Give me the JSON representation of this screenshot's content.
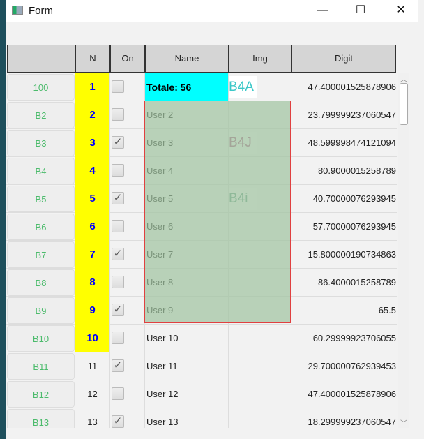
{
  "window": {
    "title": "Form",
    "minimize": "—",
    "maximize": "☐",
    "close": "✕"
  },
  "columns": [
    "",
    "N",
    "On",
    "Name",
    "Img",
    "Digit"
  ],
  "rows": [
    {
      "header": "100",
      "n": "1",
      "hl": true,
      "on": false,
      "name": "Totale: 56",
      "total": true,
      "img": "B4A",
      "imgColor": "#3cc8c8",
      "digit": "47.400001525878906"
    },
    {
      "header": "B2",
      "n": "2",
      "hl": true,
      "on": false,
      "name": "User 2",
      "img": "",
      "digit": "23.799999237060547"
    },
    {
      "header": "B3",
      "n": "3",
      "hl": true,
      "on": true,
      "name": "User 3",
      "img": "B4J",
      "imgColor": "#b0608a",
      "digit": "48.599998474121094"
    },
    {
      "header": "B4",
      "n": "4",
      "hl": true,
      "on": false,
      "name": "User 4",
      "img": "",
      "digit": "80.9000015258789"
    },
    {
      "header": "B5",
      "n": "5",
      "hl": true,
      "on": true,
      "name": "User 5",
      "img": "B4i",
      "imgColor": "#6aa08a",
      "digit": "40.70000076293945"
    },
    {
      "header": "B6",
      "n": "6",
      "hl": true,
      "on": false,
      "name": "User 6",
      "img": "",
      "digit": "57.70000076293945"
    },
    {
      "header": "B7",
      "n": "7",
      "hl": true,
      "on": true,
      "name": "User 7",
      "img": "",
      "digit": "15.800000190734863"
    },
    {
      "header": "B8",
      "n": "8",
      "hl": true,
      "on": false,
      "name": "User 8",
      "img": "",
      "digit": "86.4000015258789"
    },
    {
      "header": "B9",
      "n": "9",
      "hl": true,
      "on": true,
      "name": "User 9",
      "img": "",
      "digit": "65.5"
    },
    {
      "header": "B10",
      "n": "10",
      "hl": true,
      "on": false,
      "name": "User 10",
      "img": "",
      "digit": "60.29999923706055"
    },
    {
      "header": "B11",
      "n": "11",
      "hl": false,
      "on": true,
      "name": "User 11",
      "img": "",
      "digit": "29.700000762939453"
    },
    {
      "header": "B12",
      "n": "12",
      "hl": false,
      "on": false,
      "name": "User 12",
      "img": "",
      "digit": "47.400001525878906"
    },
    {
      "header": "B13",
      "n": "13",
      "hl": false,
      "on": true,
      "name": "User 13",
      "img": "",
      "digit": "18.299999237060547"
    }
  ]
}
